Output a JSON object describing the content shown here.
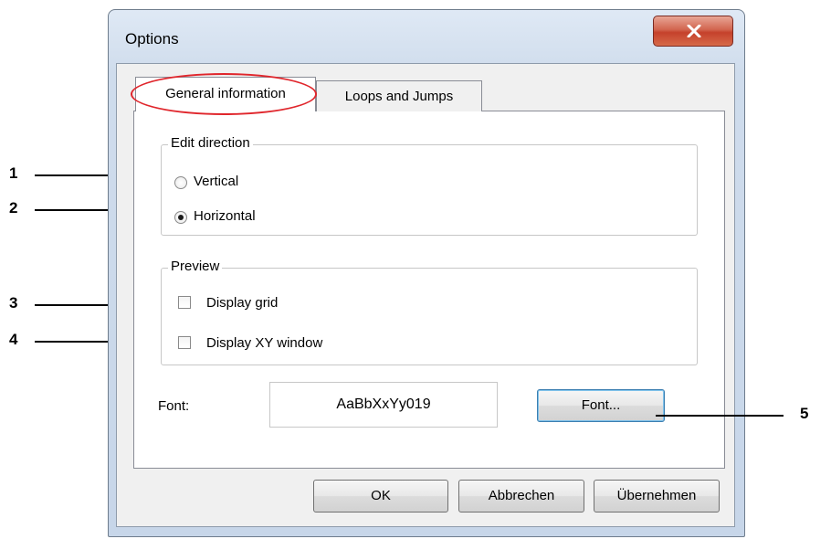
{
  "window": {
    "title": "Options",
    "close_glyph": "✕"
  },
  "tabs": [
    {
      "label": "General information",
      "active": true
    },
    {
      "label": "Loops and Jumps",
      "active": false
    }
  ],
  "edit_direction": {
    "legend": "Edit direction",
    "options": [
      {
        "label": "Vertical",
        "checked": false
      },
      {
        "label": "Horizontal",
        "checked": true
      }
    ]
  },
  "preview": {
    "legend": "Preview",
    "options": [
      {
        "label": "Display grid",
        "checked": false
      },
      {
        "label": "Display XY window",
        "checked": false
      }
    ]
  },
  "font": {
    "label": "Font:",
    "sample": "AaBbXxYy019",
    "button": "Font..."
  },
  "buttons": {
    "ok": "OK",
    "cancel": "Abbrechen",
    "apply": "Übernehmen"
  },
  "callouts": [
    "1",
    "2",
    "3",
    "4",
    "5"
  ],
  "colors": {
    "highlight_ellipse": "#e0262c",
    "close_button": "#c5412b"
  }
}
